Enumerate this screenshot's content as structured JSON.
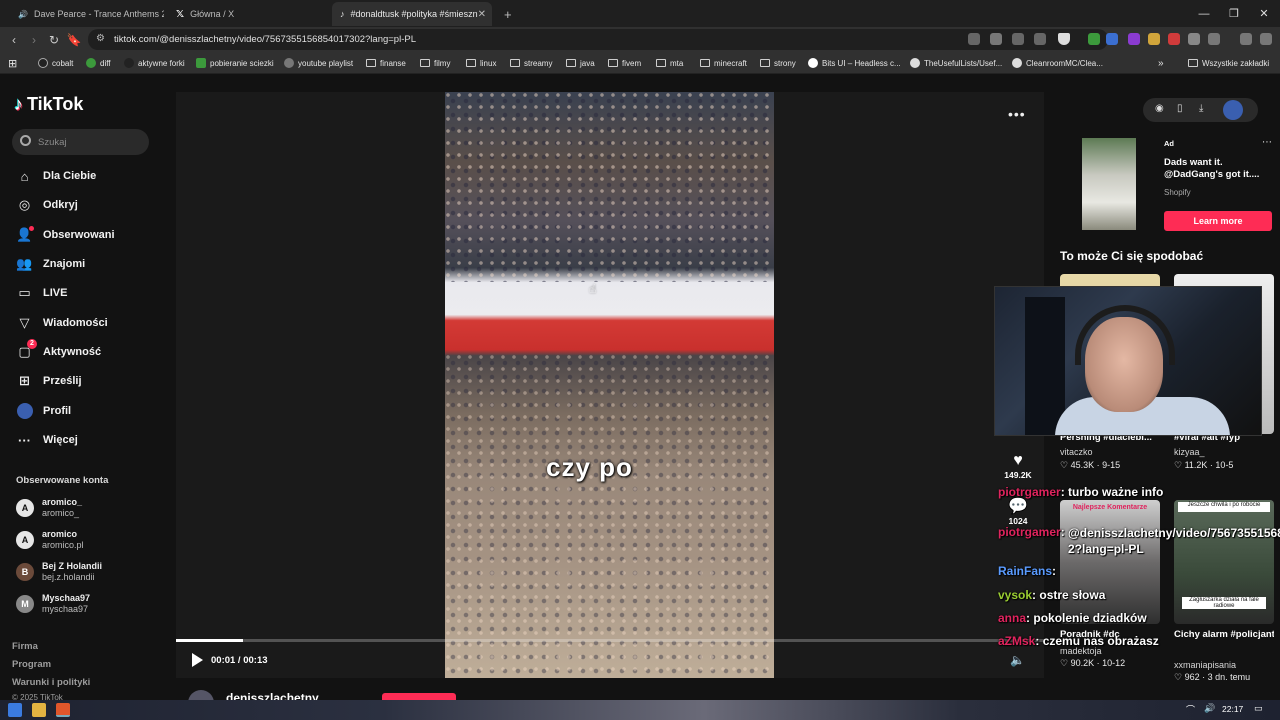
{
  "browser": {
    "tabs": [
      {
        "label": "Dave Pearce - Trance Anthems 20",
        "active": false
      },
      {
        "label": "Główna / X",
        "active": false
      },
      {
        "label": "#donaldtusk #polityka #śmieszn",
        "active": true
      }
    ],
    "new_tab": "+",
    "url": "tiktok.com/@denisszlachetny/video/7567355156854017302?lang=pl-PL",
    "bookmarks": [
      "cobalt",
      "diff",
      "aktywne forki",
      "pobieranie sciezki",
      "youtube playlist",
      "finanse",
      "filmy",
      "linux",
      "streamy",
      "java",
      "fivem",
      "mta",
      "minecraft",
      "strony",
      "Bits UI – Headless c...",
      "TheUsefulLists/Usef...",
      "CleanroomMC/Clea...",
      "Wszystkie zakładki"
    ],
    "more_bookmarks": "»"
  },
  "tiktok": {
    "logo": "TikTok",
    "search_placeholder": "Szukaj",
    "nav": [
      {
        "label": "Dla Ciebie",
        "icon": "home-icon"
      },
      {
        "label": "Odkryj",
        "icon": "compass-icon"
      },
      {
        "label": "Obserwowani",
        "icon": "following-icon"
      },
      {
        "label": "Znajomi",
        "icon": "friends-icon"
      },
      {
        "label": "LIVE",
        "icon": "live-icon"
      },
      {
        "label": "Wiadomości",
        "icon": "messages-icon"
      },
      {
        "label": "Aktywność",
        "icon": "activity-icon",
        "badge": "2"
      },
      {
        "label": "Prześlij",
        "icon": "upload-icon"
      },
      {
        "label": "Profil",
        "icon": "profile-icon"
      },
      {
        "label": "Więcej",
        "icon": "more-icon"
      }
    ],
    "followed_title": "Obserwowane konta",
    "followed": [
      {
        "name": "aromico_",
        "handle": "aromico_"
      },
      {
        "name": "aromico",
        "handle": "aromico.pl"
      },
      {
        "name": "Bej Z Holandii",
        "handle": "bej.z.holandii"
      },
      {
        "name": "Myschaa97",
        "handle": "myschaa97"
      }
    ],
    "footer": [
      "Firma",
      "Program",
      "Warunki i polityki",
      "© 2025 TikTok"
    ],
    "player": {
      "caption": "czy po",
      "time": "00:01 / 00:13",
      "progress": 0.077,
      "likes": "149.2K",
      "comments": "1024",
      "author": "denisszlachetny"
    },
    "ad": {
      "label": "Ad",
      "title": "Dads want it. @DadGang's got it....",
      "brand": "Shopify",
      "cta": "Learn more"
    },
    "recommend_title": "To może Ci się spodobać",
    "cards": [
      {
        "title": "Pershing #dlaciebi...",
        "author": "vitaczko",
        "stats": "45.3K · 9-15"
      },
      {
        "title": "#viral #alt #fyp",
        "author": "kizyaa_",
        "stats": "11.2K · 10-5"
      },
      {
        "title": "Poradnik #dc",
        "author": "madektoja",
        "stats": "90.2K · 10-12",
        "overlay": "Najlepsze Komentarze"
      },
      {
        "title": "Cichy alarm #policjantkiipolicja...",
        "author": "xxmaniapisania",
        "stats": "962 · 3 dn. temu",
        "overlay": "Jeszcze chwila i po robocie",
        "overlay2": "Zagłuszarka działa na fale radiowe"
      }
    ]
  },
  "stream_chat": [
    {
      "user": "piotrgamer",
      "msg": "turbo ważne info",
      "color": "red"
    },
    {
      "user": "piotrgamer",
      "msg": "@denisszlachetny/video/7567355156854017302?lang=pl-PL",
      "color": "red"
    },
    {
      "user": "RainFans",
      "msg": "",
      "color": "blue"
    },
    {
      "user": "vysok",
      "msg": "ostre słowa",
      "color": "green"
    },
    {
      "user": "anna",
      "msg": "pokolenie dziadków",
      "color": "red"
    },
    {
      "user": "aZMsk",
      "msg": "czemu nas obrażasz",
      "color": "red"
    }
  ],
  "taskbar": {
    "clock": "22:17"
  },
  "colors": {
    "accent": "#fe2c55",
    "bg": "#121212"
  }
}
